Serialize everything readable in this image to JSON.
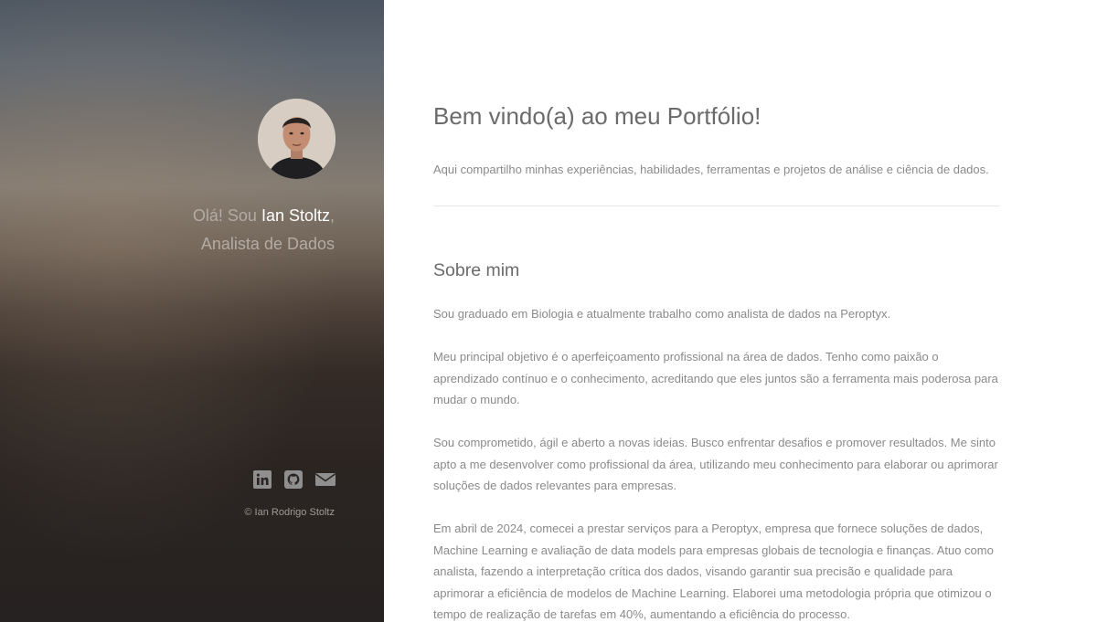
{
  "sidebar": {
    "greeting_prefix": "Olá! Sou ",
    "name": "Ian Stoltz",
    "greeting_suffix": ",",
    "role": "Analista de Dados",
    "social": [
      {
        "icon": "linkedin-icon"
      },
      {
        "icon": "github-icon"
      },
      {
        "icon": "envelope-icon"
      }
    ],
    "copyright": "© Ian Rodrigo Stoltz"
  },
  "main": {
    "title": "Bem vindo(a) ao meu Portfólio!",
    "subtitle": "Aqui compartilho minhas experiências, habilidades, ferramentas e projetos de análise e ciência de dados.",
    "about": {
      "heading": "Sobre mim",
      "paragraphs": [
        "Sou graduado em Biologia e atualmente trabalho como analista de dados na Peroptyx.",
        "Meu principal objetivo é o aperfeiçoamento profissional na área de dados. Tenho como paixão o aprendizado contínuo e o conhecimento, acreditando que eles juntos são a ferramenta mais poderosa para mudar o mundo.",
        "Sou comprometido, ágil e aberto a novas ideias. Busco enfrentar desafios e promover resultados. Me sinto apto a me desenvolver como profissional da área, utilizando meu conhecimento para elaborar ou aprimorar soluções de dados relevantes para empresas.",
        "Em abril de 2024, comecei a prestar serviços para a Peroptyx, empresa que fornece soluções de dados, Machine Learning e avaliação de data models para empresas globais de tecnologia e finanças. Atuo como analista, fazendo a interpretação crítica dos dados, visando garantir sua precisão e qualidade para aprimorar a eficiência de modelos de Machine Learning. Elaborei uma metodologia própria que otimizou o tempo de realização de tarefas em 40%, aumentando a eficiência do processo."
      ]
    }
  },
  "colors": {
    "sidebar_text": "#b3aca4",
    "name_highlight": "#ffffff",
    "body_text": "#8a8a8a",
    "heading_text": "#6b6b6b",
    "icon": "#8f8f8f"
  }
}
